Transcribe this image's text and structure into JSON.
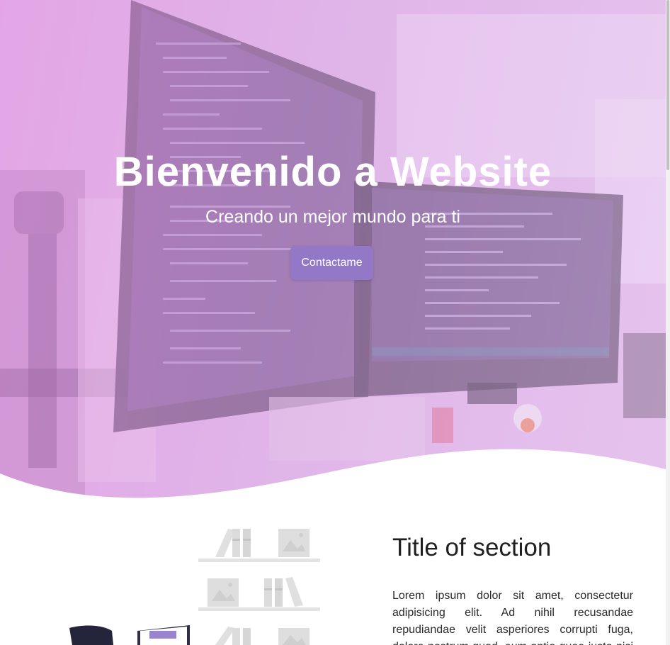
{
  "hero": {
    "title": "Bienvenido a Website",
    "subtitle": "Creando un mejor mundo para ti",
    "cta_label": "Contactame"
  },
  "section": {
    "title": "Title of section",
    "text": "Lorem ipsum dolor sit amet, consectetur adipisicing elit. Ad nihil recusandae repudiandae velit asperiores corrupti fuga, dolore nostrum quod, eum optio quae iusto nisi dolor."
  },
  "colors": {
    "accent": "#9478c8",
    "hero_tint": "#dca6e6",
    "text_dark": "#1f1f1f"
  }
}
